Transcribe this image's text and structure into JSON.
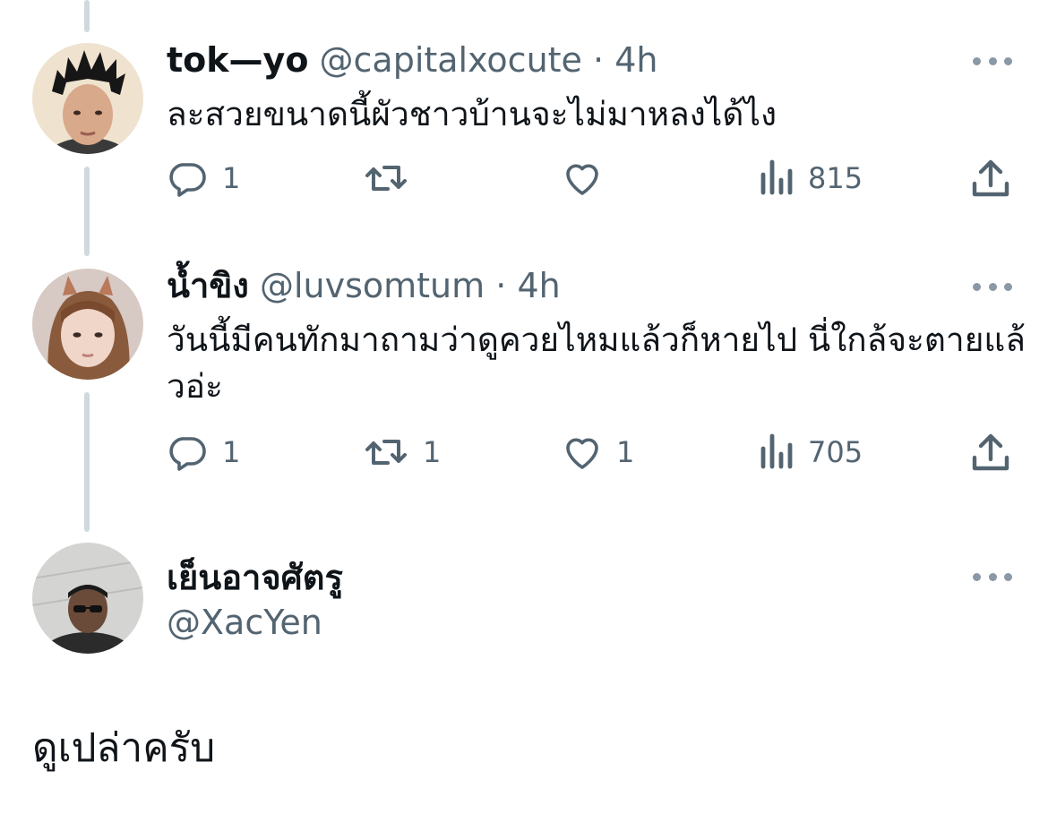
{
  "replies": [
    {
      "name": "tok—yo",
      "handle": "@capitalxocute",
      "dot": "·",
      "time": "4h",
      "text": "ละสวยขนาดนี้ผัวชาวบ้านจะไม่มาหลงได้ไง",
      "reply_count": "1",
      "retweet_count": "",
      "like_count": "",
      "view_count": "815"
    },
    {
      "name": "น้ำขิง",
      "handle": "@luvsomtum",
      "dot": "·",
      "time": "4h",
      "text": "วันนี้มีคนทักมาถามว่าดูควยไหมแล้วก็หายไป นี่ใกล้จะตายแล้วอ่ะ",
      "reply_count": "1",
      "retweet_count": "1",
      "like_count": "1",
      "view_count": "705"
    }
  ],
  "main_tweet": {
    "name": "เย็นอาจศัตรู",
    "handle": "@XacYen",
    "text": "ดูเปล่าครับ"
  },
  "icons": {
    "reply": "reply-bubble-icon",
    "retweet": "retweet-icon",
    "like": "heart-icon",
    "views": "analytics-bars-icon",
    "share": "share-upload-icon",
    "more": "more-dots-icon"
  },
  "colors": {
    "text": "#0f1419",
    "secondary": "#536471",
    "thread_line": "#cfd9de",
    "background": "#ffffff"
  }
}
